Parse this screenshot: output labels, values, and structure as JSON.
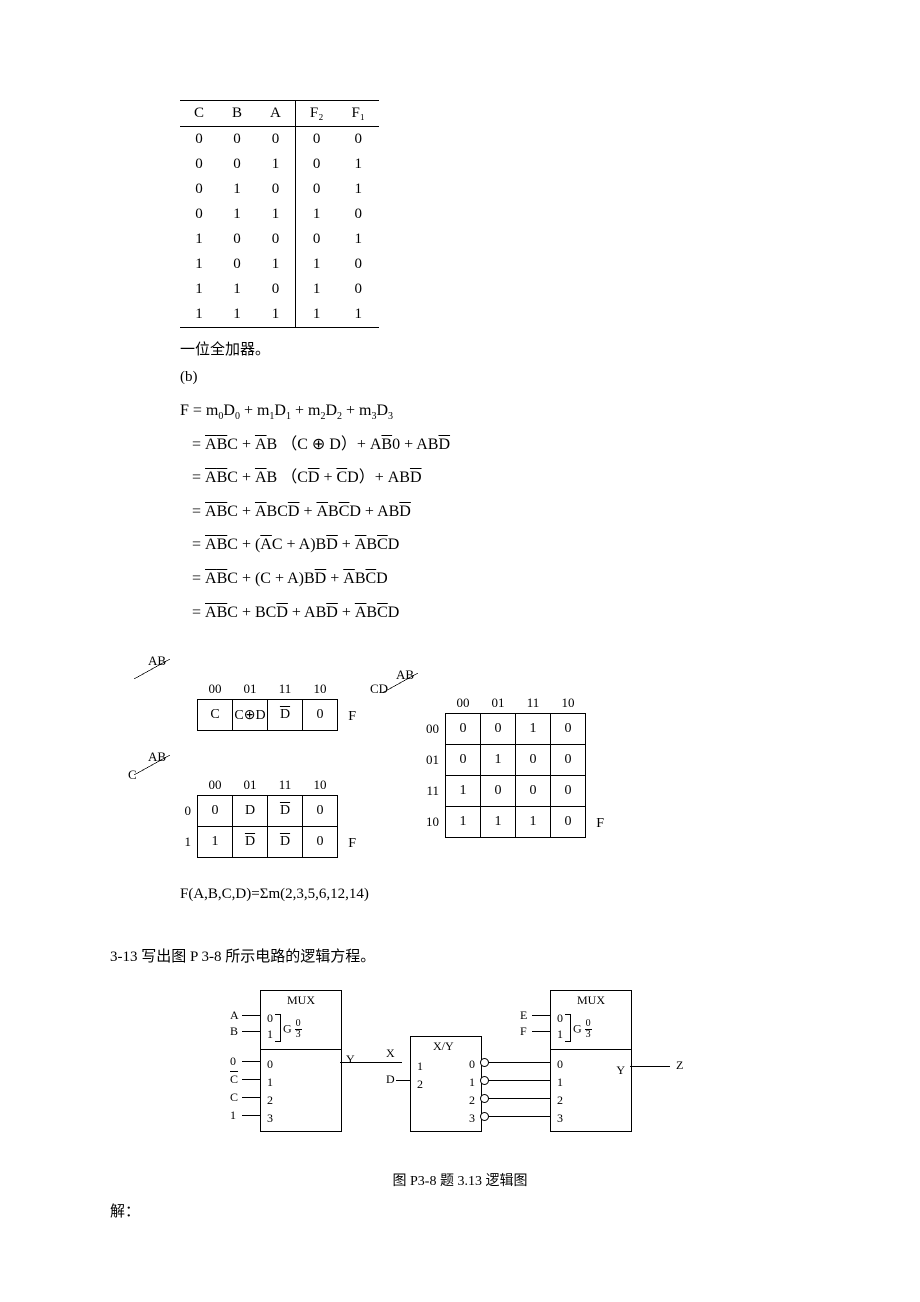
{
  "truth_table": {
    "headers": [
      "C",
      "B",
      "A",
      "F₂",
      "F₁"
    ],
    "rows": [
      [
        "0",
        "0",
        "0",
        "0",
        "0"
      ],
      [
        "0",
        "0",
        "1",
        "0",
        "1"
      ],
      [
        "0",
        "1",
        "0",
        "0",
        "1"
      ],
      [
        "0",
        "1",
        "1",
        "1",
        "0"
      ],
      [
        "1",
        "0",
        "0",
        "0",
        "1"
      ],
      [
        "1",
        "0",
        "1",
        "1",
        "0"
      ],
      [
        "1",
        "1",
        "0",
        "1",
        "0"
      ],
      [
        "1",
        "1",
        "1",
        "1",
        "1"
      ]
    ]
  },
  "text": {
    "full_adder": "一位全加器。",
    "part_b": "(b)",
    "sum_line": "F(A,B,C,D)=Σm(2,3,5,6,12,14)",
    "problem": "3-13  写出图 P 3-8 所示电路的逻辑方程。",
    "caption": "图 P3-8  题 3.13 逻辑图",
    "answer": "解："
  },
  "equations": {
    "line1_left": "F = m",
    "m_terms": [
      "0",
      "1",
      "2",
      "3"
    ],
    "d_terms": [
      "0",
      "1",
      "2",
      "3"
    ]
  },
  "kmap1": {
    "top_var": "AB",
    "left_var": "",
    "cols": [
      "00",
      "01",
      "11",
      "10"
    ],
    "rows": [
      {
        "head": "",
        "cells": [
          "C",
          "C⊕D",
          "D̄",
          "0"
        ]
      }
    ],
    "out": "F"
  },
  "kmap2": {
    "top_var": "AB",
    "left_var": "C",
    "cols": [
      "00",
      "01",
      "11",
      "10"
    ],
    "rows": [
      {
        "head": "0",
        "cells": [
          "0",
          "D",
          "D̄",
          "0"
        ]
      },
      {
        "head": "1",
        "cells": [
          "1",
          "D̄",
          "D̄",
          "0"
        ]
      }
    ],
    "out": "F"
  },
  "kmap3": {
    "top_var": "AB",
    "left_var": "CD",
    "cols": [
      "00",
      "01",
      "11",
      "10"
    ],
    "rows": [
      {
        "head": "00",
        "cells": [
          "0",
          "0",
          "1",
          "0"
        ]
      },
      {
        "head": "01",
        "cells": [
          "0",
          "1",
          "0",
          "0"
        ]
      },
      {
        "head": "11",
        "cells": [
          "1",
          "0",
          "0",
          "0"
        ]
      },
      {
        "head": "10",
        "cells": [
          "1",
          "1",
          "1",
          "0"
        ]
      }
    ],
    "out": "F"
  },
  "circuit": {
    "mux1": {
      "title": "MUX",
      "sel_label": "G",
      "frac_top": "0",
      "frac_bot": "3",
      "sel_pins": [
        "0",
        "1"
      ],
      "data_pins": [
        "0",
        "1",
        "2",
        "3"
      ],
      "sel_sigs": [
        "A",
        "B"
      ],
      "data_sigs": [
        "0",
        "C̄",
        "C",
        "1"
      ],
      "out": "Y"
    },
    "dec": {
      "title": "X/Y",
      "in_pins": [
        "1",
        "2"
      ],
      "out_pins": [
        "0",
        "1",
        "2",
        "3"
      ],
      "in_sigs": [
        "X",
        "D"
      ]
    },
    "mux2": {
      "title": "MUX",
      "sel_label": "G",
      "frac_top": "0",
      "frac_bot": "3",
      "sel_pins": [
        "0",
        "1"
      ],
      "data_pins": [
        "0",
        "1",
        "2",
        "3"
      ],
      "sel_sigs": [
        "E",
        "F"
      ],
      "out": "Y",
      "out_sig": "Z"
    }
  },
  "chart_data": [
    {
      "type": "table",
      "title": "Truth table (1-bit full adder)",
      "columns": [
        "C",
        "B",
        "A",
        "F2",
        "F1"
      ],
      "rows": [
        [
          0,
          0,
          0,
          0,
          0
        ],
        [
          0,
          0,
          1,
          0,
          1
        ],
        [
          0,
          1,
          0,
          0,
          1
        ],
        [
          0,
          1,
          1,
          1,
          0
        ],
        [
          1,
          0,
          0,
          0,
          1
        ],
        [
          1,
          0,
          1,
          1,
          0
        ],
        [
          1,
          1,
          0,
          1,
          0
        ],
        [
          1,
          1,
          1,
          1,
          1
        ]
      ]
    },
    {
      "type": "table",
      "title": "K-map F over AB (single row)",
      "columns": [
        "AB=00",
        "AB=01",
        "AB=11",
        "AB=10"
      ],
      "rows": [
        [
          "C",
          "C⊕D",
          "D̄",
          "0"
        ]
      ]
    },
    {
      "type": "table",
      "title": "K-map F over AB,C",
      "columns": [
        "C",
        "AB=00",
        "AB=01",
        "AB=11",
        "AB=10"
      ],
      "rows": [
        [
          "0",
          "0",
          "D",
          "D̄",
          "0"
        ],
        [
          "1",
          "1",
          "D̄",
          "D̄",
          "0"
        ]
      ]
    },
    {
      "type": "table",
      "title": "K-map F over AB,CD",
      "columns": [
        "CD",
        "AB=00",
        "AB=01",
        "AB=11",
        "AB=10"
      ],
      "rows": [
        [
          "00",
          0,
          0,
          1,
          0
        ],
        [
          "01",
          0,
          1,
          0,
          0
        ],
        [
          "11",
          1,
          0,
          0,
          0
        ],
        [
          "10",
          1,
          1,
          1,
          0
        ]
      ]
    }
  ]
}
